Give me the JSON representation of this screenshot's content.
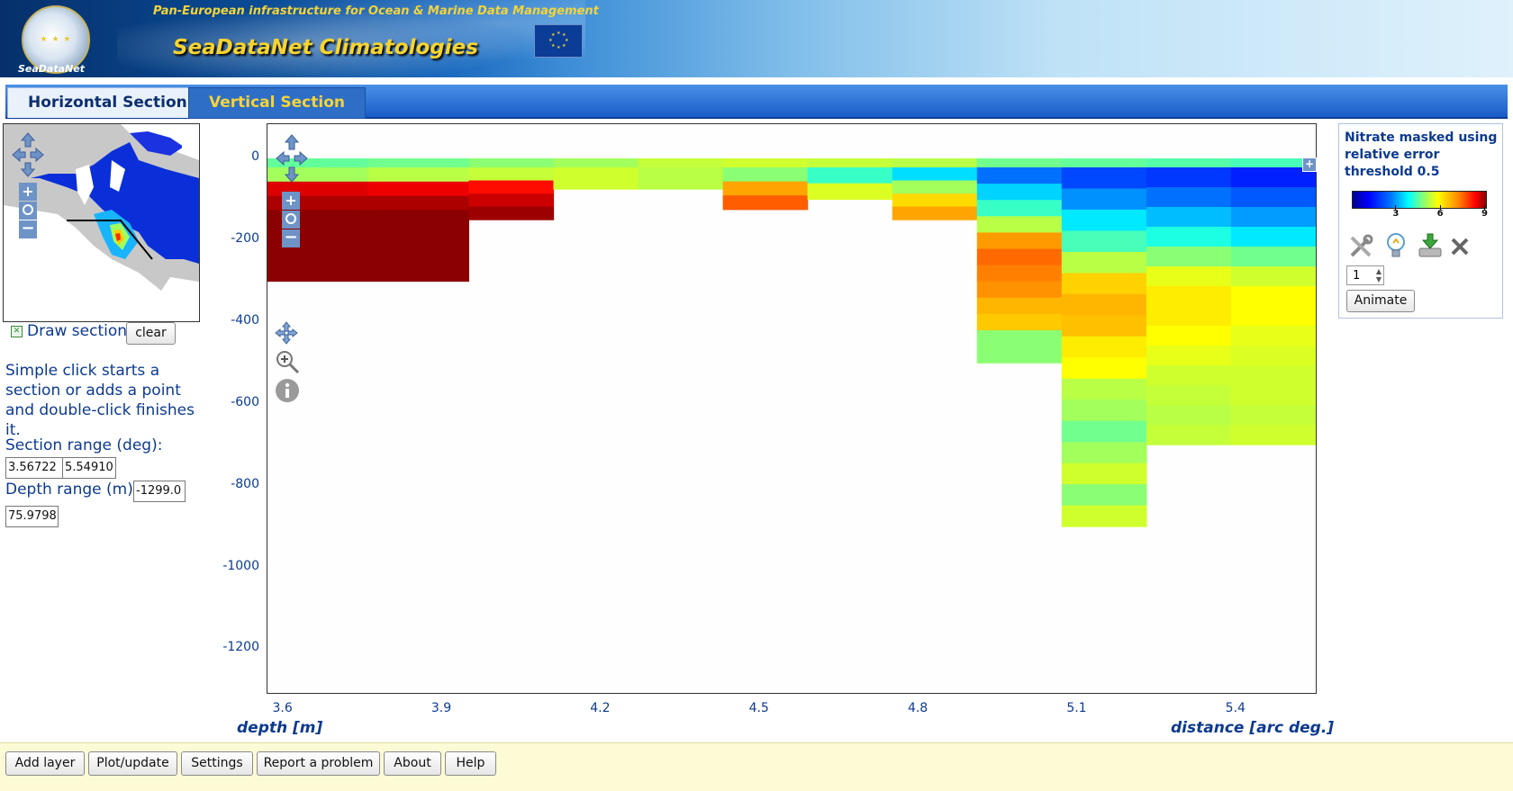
{
  "header": {
    "tagline": "Pan-European infrastructure for Ocean & Marine Data Management",
    "app_title": "SeaDataNet Climatologies",
    "logo_text": "SeaDataNet",
    "eu_flag": "eu-flag"
  },
  "tabs": [
    {
      "label": "Horizontal Section",
      "active": true
    },
    {
      "label": "Vertical Section",
      "active": false
    }
  ],
  "left_panel": {
    "draw_section_label": "Draw section",
    "draw_section_checked": true,
    "clear_button": "clear",
    "help_text": "Simple click starts a section or adds a point and double-click finishes it.",
    "section_range_label": "Section range (deg):",
    "section_range_min": "3.56722",
    "section_range_max": "5.54910",
    "depth_range_label": "Depth range (m):",
    "depth_range_min": "-1299.0",
    "depth_range_max": "75.9798"
  },
  "map_controls": [
    "pan-icon",
    "zoom-in-icon",
    "zoom-reset-icon",
    "zoom-out-icon"
  ],
  "plot_tools": [
    "pan-tool-icon",
    "zoom-box-icon",
    "info-icon"
  ],
  "chart_data": {
    "type": "heatmap",
    "xlabel": "distance [arc deg.]",
    "ylabel": "depth [m]",
    "x_ticks": [
      "3.6",
      "3.9",
      "4.2",
      "4.5",
      "4.8",
      "5.1",
      "5.4"
    ],
    "y_ticks": [
      "0",
      "-200",
      "-400",
      "-600",
      "-800",
      "-1000",
      "-1200"
    ],
    "xlim": [
      3.57,
      5.55
    ],
    "ylim": [
      -1299,
      76
    ],
    "colorscale": {
      "min": 0,
      "max": 9,
      "ticks": [
        "3",
        "6",
        "9"
      ]
    },
    "columns": [
      {
        "x0": 3.57,
        "x1": 3.76,
        "bottom": -300,
        "values": [
          4.5,
          5.0,
          8.5,
          8.8,
          9.0,
          9.2,
          9.2,
          9.3,
          9.3
        ]
      },
      {
        "x0": 3.76,
        "x1": 3.95,
        "bottom": -300,
        "values": [
          4.6,
          5.2,
          8.4,
          8.8,
          9.0,
          9.2,
          9.2,
          9.3,
          9.3
        ]
      },
      {
        "x0": 3.95,
        "x1": 4.11,
        "bottom": -150,
        "values": [
          4.8,
          5.3,
          8.2,
          8.6,
          8.9
        ]
      },
      {
        "x0": 4.11,
        "x1": 4.27,
        "bottom": -75,
        "values": [
          5.0,
          5.4
        ]
      },
      {
        "x0": 4.27,
        "x1": 4.43,
        "bottom": -75,
        "values": [
          5.3,
          5.2
        ]
      },
      {
        "x0": 4.43,
        "x1": 4.59,
        "bottom": -125,
        "values": [
          5.4,
          4.8,
          6.8,
          7.5
        ]
      },
      {
        "x0": 4.59,
        "x1": 4.75,
        "bottom": -100,
        "values": [
          5.3,
          4.2,
          5.5
        ]
      },
      {
        "x0": 4.75,
        "x1": 4.91,
        "bottom": -150,
        "values": [
          5.2,
          3.5,
          5.0,
          6.2,
          6.8
        ]
      },
      {
        "x0": 4.91,
        "x1": 5.07,
        "bottom": -500,
        "values": [
          4.6,
          2.5,
          3.4,
          4.2,
          5.2,
          6.9,
          7.4,
          7.2,
          7.0,
          6.6,
          6.4,
          4.8,
          4.8
        ]
      },
      {
        "x0": 5.07,
        "x1": 5.23,
        "bottom": -900,
        "values": [
          4.5,
          2.0,
          2.8,
          3.6,
          4.3,
          5.2,
          6.3,
          6.6,
          6.5,
          6.0,
          5.8,
          5.2,
          5.0,
          4.6,
          5.0,
          5.4,
          4.8,
          5.4
        ]
      },
      {
        "x0": 5.23,
        "x1": 5.39,
        "bottom": -700,
        "values": [
          4.4,
          1.8,
          2.5,
          3.2,
          4.0,
          4.8,
          5.6,
          6.0,
          6.0,
          5.8,
          5.6,
          5.4,
          5.3,
          5.2,
          5.3
        ]
      },
      {
        "x0": 5.39,
        "x1": 5.55,
        "bottom": -700,
        "values": [
          4.3,
          1.5,
          2.2,
          2.9,
          3.6,
          4.6,
          5.4,
          5.8,
          5.8,
          5.6,
          5.5,
          5.4,
          5.4,
          5.3,
          5.4
        ]
      }
    ]
  },
  "legend": {
    "title": "Nitrate masked using relative error threshold 0.5",
    "tools": [
      "settings-icon",
      "highlight-icon",
      "download-icon",
      "remove-icon"
    ],
    "frame_value": "1",
    "animate_button": "Animate"
  },
  "footer": {
    "buttons": [
      "Add layer",
      "Plot/update",
      "Settings",
      "Report a problem",
      "About",
      "Help"
    ]
  }
}
